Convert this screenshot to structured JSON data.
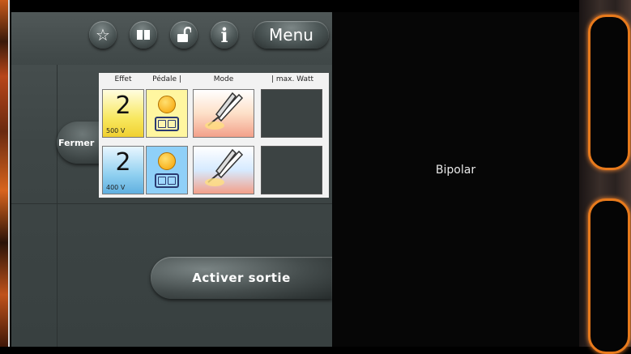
{
  "toolbar": {
    "buttons": [
      {
        "icon": "star-icon",
        "glyph": "☆"
      },
      {
        "icon": "book-icon",
        "glyph": "▮"
      },
      {
        "icon": "unlock-icon",
        "glyph": "🔓"
      },
      {
        "icon": "info-icon",
        "glyph": "i"
      }
    ],
    "menu_label": "Menu"
  },
  "fermer_label": "Fermer",
  "activer_label": "Activer sortie",
  "table": {
    "headers": [
      "Effet",
      "Pédale |",
      "Mode",
      "| max. Watt"
    ],
    "rows": [
      {
        "effect": "2",
        "voltage": "500 V",
        "color": "yellow"
      },
      {
        "effect": "2",
        "voltage": "400 V",
        "color": "blue"
      }
    ]
  },
  "status": {
    "mode": "Bipolar"
  },
  "colors": {
    "accent_orange": "#e87a1c",
    "screen_bg": "#3e4646"
  }
}
